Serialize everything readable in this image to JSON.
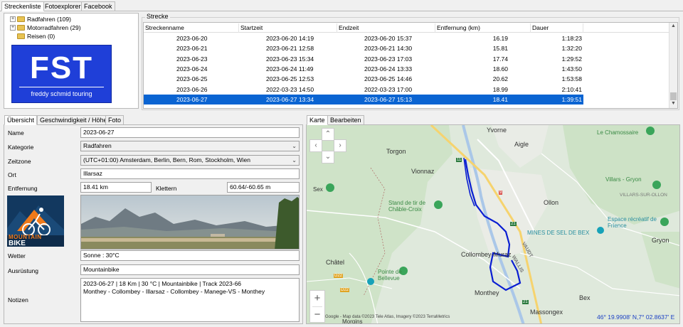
{
  "top_tabs": [
    "Streckenliste",
    "Fotoexplorer",
    "Facebook"
  ],
  "tree": [
    {
      "label": "Radfahren (109)"
    },
    {
      "label": "Motorradfahren (29)"
    },
    {
      "label": "Reisen (0)"
    }
  ],
  "logo": {
    "big": "FST",
    "sub": "freddy schmid touring",
    "color": "#1f3fd8"
  },
  "strecke": {
    "title": "Strecke",
    "columns": [
      "Streckenname",
      "Startzeit",
      "Endzeit",
      "Entfernung (km)",
      "Dauer"
    ],
    "rows": [
      [
        "2023-06-20",
        "2023-06-20 14:19",
        "2023-06-20 15:37",
        "16.19",
        "1:18:23"
      ],
      [
        "2023-06-21",
        "2023-06-21 12:58",
        "2023-06-21 14:30",
        "15.81",
        "1:32:20"
      ],
      [
        "2023-06-23",
        "2023-06-23 15:34",
        "2023-06-23 17:03",
        "17.74",
        "1:29:52"
      ],
      [
        "2023-06-24",
        "2023-06-24 11:49",
        "2023-06-24 13:33",
        "18.60",
        "1:43:50"
      ],
      [
        "2023-06-25",
        "2023-06-25 12:53",
        "2023-06-25 14:46",
        "20.62",
        "1:53:58"
      ],
      [
        "2023-06-26",
        "2022-03-23 14:50",
        "2022-03-23 17:00",
        "18.99",
        "2:10:41"
      ],
      [
        "2023-06-27",
        "2023-06-27 13:34",
        "2023-06-27 15:13",
        "18.41",
        "1:39:51"
      ]
    ],
    "selected_row": 6
  },
  "detail_tabs": [
    "Übersicht",
    "Geschwindigkeit / Höhe",
    "Foto"
  ],
  "detail": {
    "name_label": "Name",
    "name": "2023-06-27",
    "kategorie_label": "Kategorie",
    "kategorie": "Radfahren",
    "zeitzone_label": "Zeitzone",
    "zeitzone": "(UTC+01:00) Amsterdam, Berlin, Bern, Rom, Stockholm, Wien",
    "ort_label": "Ort",
    "ort": "Illarsaz",
    "entfernung_label": "Entfernung",
    "entfernung": "18.41 km",
    "klettern_label": "Klettern",
    "klettern": "60.64/-60.65 m",
    "wetter_label": "Wetter",
    "wetter": "Sonne  :  30°C",
    "ausruestung_label": "Ausrüstung",
    "ausruestung": "Mountainbike",
    "notizen_label": "Notizen",
    "notizen_line1": "2023-06-27   | 18 Km | 30 °C | Mountainbike  |  Track 2023-66",
    "notizen_line2": "Monthey - Collombey - Illarsaz - Collombey - Manege-VS - Monthey",
    "badge_line1": "MOUNTAIN",
    "badge_line2": "BIKE"
  },
  "map_tabs": [
    "Karte",
    "Bearbeiten"
  ],
  "map": {
    "places": [
      "Yvorne",
      "Le Chamossaire",
      "Aigle",
      "Torgon",
      "Vionnaz",
      "Villars - Gryon",
      "VILLARS-SUR-OLLON",
      "Stand de tir de Châble-Croix",
      "Ollon",
      "Espace récréatif de Frience",
      "MINES DE SEL DE BEX",
      "Collombey-Muraz",
      "VAUDT",
      "WALLIS",
      "Gryon",
      "Châtel",
      "Pointe de Bellevue",
      "Monthey",
      "Bex",
      "Massongex",
      "Morgins",
      "Sex"
    ],
    "road_labels": [
      "11",
      "9",
      "21",
      "D22",
      "D22",
      "21"
    ],
    "attribution": "Google - Map data ©2023 Tele Atlas, Imagery ©2023 TerraMetrics",
    "coordinates": "46° 19.9908' N,7° 02.8637' E",
    "zoom_in": "+",
    "zoom_out": "−",
    "route_color": "#0a1ed2"
  }
}
